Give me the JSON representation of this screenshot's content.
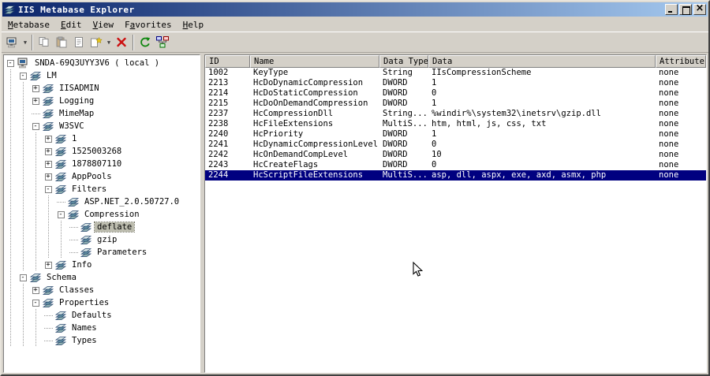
{
  "window": {
    "title": "IIS Metabase Explorer",
    "controls": [
      {
        "name": "minimize-button",
        "glyph": "minimize"
      },
      {
        "name": "maximize-button",
        "glyph": "maximize"
      },
      {
        "name": "close-button",
        "glyph": "close"
      }
    ]
  },
  "menu": {
    "items": [
      {
        "label": "Metabase",
        "hotkey": 0
      },
      {
        "label": "Edit",
        "hotkey": 0
      },
      {
        "label": "View",
        "hotkey": 0
      },
      {
        "label": "Favorites",
        "hotkey": 1
      },
      {
        "label": "Help",
        "hotkey": 0
      }
    ]
  },
  "toolbar": {
    "items": [
      {
        "name": "connect",
        "icon": "computer",
        "dropdown": true
      },
      {
        "type": "sep"
      },
      {
        "name": "copy",
        "icon": "copy"
      },
      {
        "name": "paste",
        "icon": "paste"
      },
      {
        "name": "edit-record",
        "icon": "page"
      },
      {
        "name": "new-record",
        "icon": "newkey",
        "dropdown": true
      },
      {
        "name": "delete-record",
        "icon": "delete"
      },
      {
        "type": "sep"
      },
      {
        "name": "refresh",
        "icon": "refresh"
      },
      {
        "name": "network",
        "icon": "network"
      }
    ]
  },
  "tree": {
    "items": [
      {
        "label": "SNDA-69Q3UYY3V6 ( local )",
        "depth": 0,
        "expand": "minus",
        "icon": "computer"
      },
      {
        "label": "LM",
        "depth": 1,
        "expand": "minus",
        "icon": "stack"
      },
      {
        "label": "IISADMIN",
        "depth": 2,
        "expand": "plus",
        "icon": "stack"
      },
      {
        "label": "Logging",
        "depth": 2,
        "expand": "plus",
        "icon": "stack"
      },
      {
        "label": "MimeMap",
        "depth": 2,
        "expand": "none",
        "icon": "stack"
      },
      {
        "label": "W3SVC",
        "depth": 2,
        "expand": "minus",
        "icon": "stack"
      },
      {
        "label": "1",
        "depth": 3,
        "expand": "plus",
        "icon": "stack"
      },
      {
        "label": "1525003268",
        "depth": 3,
        "expand": "plus",
        "icon": "stack"
      },
      {
        "label": "1878807110",
        "depth": 3,
        "expand": "plus",
        "icon": "stack"
      },
      {
        "label": "AppPools",
        "depth": 3,
        "expand": "plus",
        "icon": "stack"
      },
      {
        "label": "Filters",
        "depth": 3,
        "expand": "minus",
        "icon": "stack"
      },
      {
        "label": "ASP.NET_2.0.50727.0",
        "depth": 4,
        "expand": "none",
        "icon": "stack"
      },
      {
        "label": "Compression",
        "depth": 4,
        "expand": "minus",
        "icon": "stack"
      },
      {
        "label": "deflate",
        "depth": 5,
        "expand": "none",
        "icon": "stack",
        "selected": true
      },
      {
        "label": "gzip",
        "depth": 5,
        "expand": "none",
        "icon": "stack"
      },
      {
        "label": "Parameters",
        "depth": 5,
        "expand": "none",
        "icon": "stack"
      },
      {
        "label": "Info",
        "depth": 3,
        "expand": "plus",
        "icon": "stack"
      },
      {
        "label": "Schema",
        "depth": 1,
        "expand": "minus",
        "icon": "stack"
      },
      {
        "label": "Classes",
        "depth": 2,
        "expand": "plus",
        "icon": "stack"
      },
      {
        "label": "Properties",
        "depth": 2,
        "expand": "minus",
        "icon": "stack"
      },
      {
        "label": "Defaults",
        "depth": 3,
        "expand": "none",
        "icon": "stack"
      },
      {
        "label": "Names",
        "depth": 3,
        "expand": "none",
        "icon": "stack"
      },
      {
        "label": "Types",
        "depth": 3,
        "expand": "none",
        "icon": "stack"
      }
    ]
  },
  "list": {
    "columns": [
      "ID",
      "Name",
      "Data Type",
      "Data",
      "Attributes"
    ],
    "selected_id": "2244",
    "rows": [
      [
        "1002",
        "KeyType",
        "String",
        "IIsCompressionScheme",
        "none"
      ],
      [
        "2213",
        "HcDoDynamicCompression",
        "DWORD",
        "1",
        "none"
      ],
      [
        "2214",
        "HcDoStaticCompression",
        "DWORD",
        "0",
        "none"
      ],
      [
        "2215",
        "HcDoOnDemandCompression",
        "DWORD",
        "1",
        "none"
      ],
      [
        "2237",
        "HcCompressionDll",
        "String...",
        "%windir%\\system32\\inetsrv\\gzip.dll",
        "none"
      ],
      [
        "2238",
        "HcFileExtensions",
        "MultiS...",
        "htm, html, js, css, txt",
        "none"
      ],
      [
        "2240",
        "HcPriority",
        "DWORD",
        "1",
        "none"
      ],
      [
        "2241",
        "HcDynamicCompressionLevel",
        "DWORD",
        "0",
        "none"
      ],
      [
        "2242",
        "HcOnDemandCompLevel",
        "DWORD",
        "10",
        "none"
      ],
      [
        "2243",
        "HcCreateFlags",
        "DWORD",
        "0",
        "none"
      ],
      [
        "2244",
        "HcScriptFileExtensions",
        "MultiS...",
        "asp, dll, aspx, exe, axd, asmx, php",
        "none"
      ]
    ]
  },
  "colors": {
    "titlebar_start": "#0a246a",
    "titlebar_end": "#a6caf0",
    "chrome": "#d4d0c8",
    "selection": "#000080",
    "tree_inactive_selection": "#bdbdaf"
  }
}
